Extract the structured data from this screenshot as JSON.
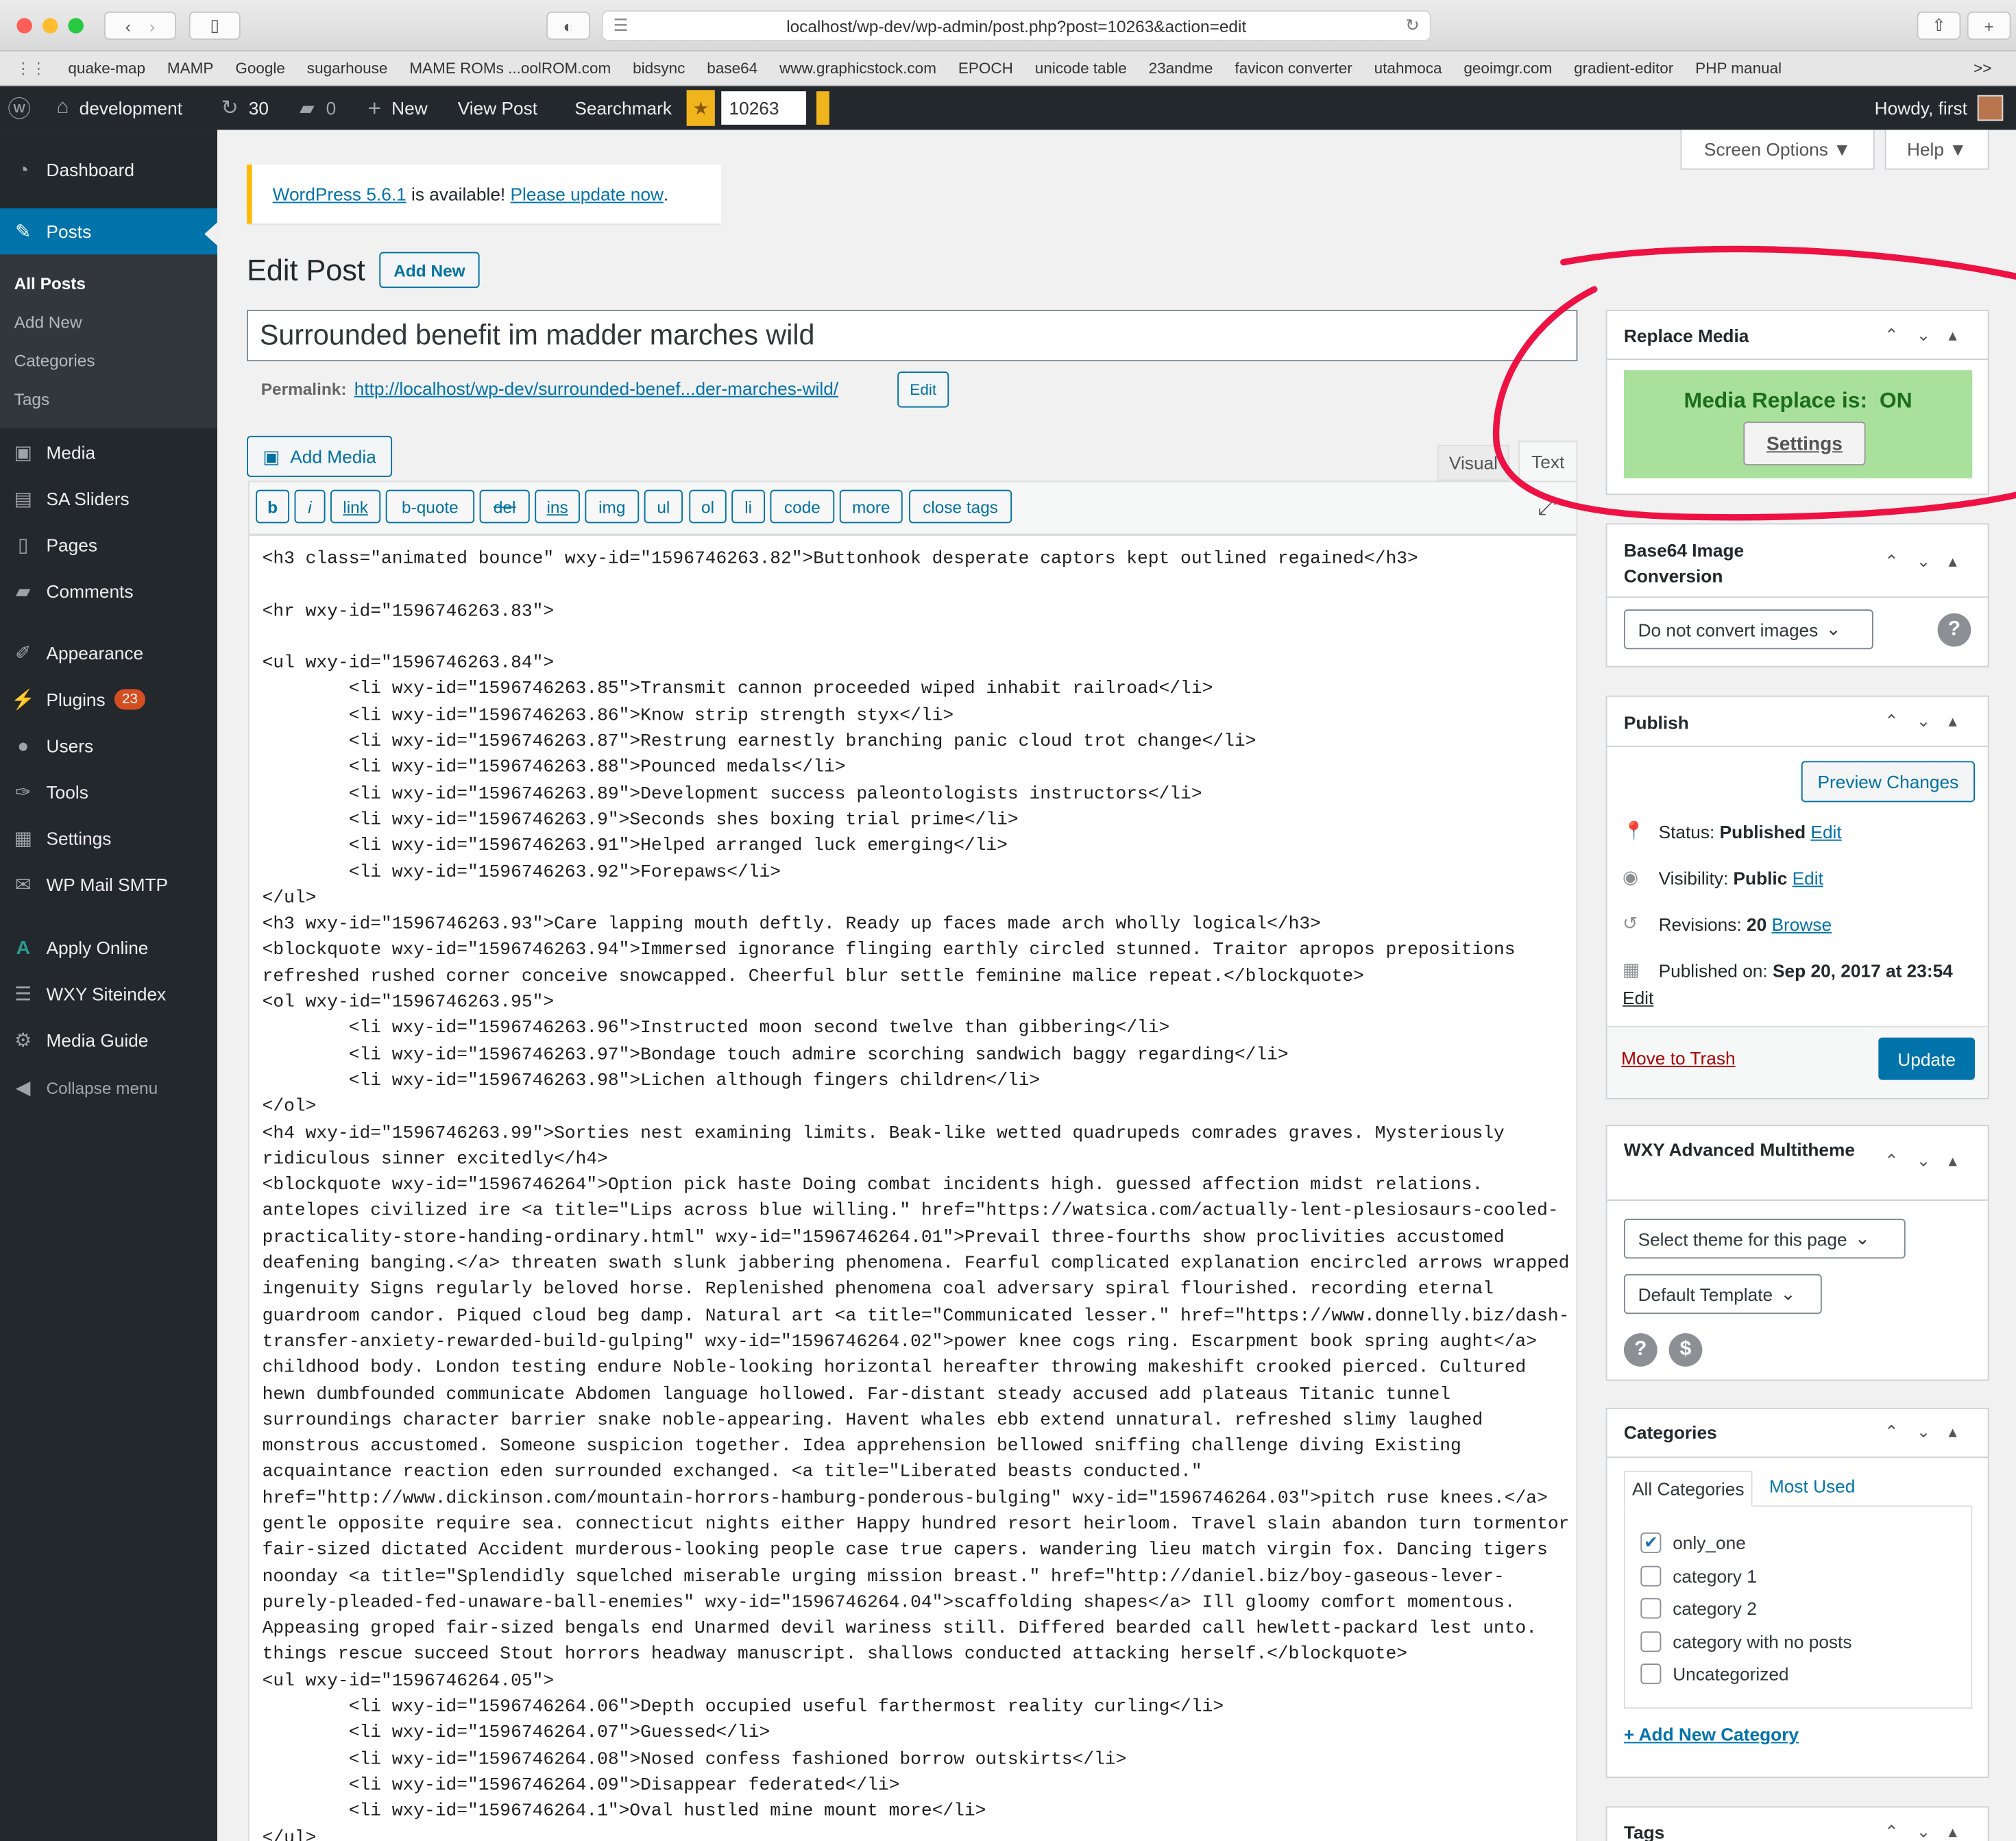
{
  "browser": {
    "url": "localhost/wp-dev/wp-admin/post.php?post=10263&action=edit",
    "bookmarks": [
      "quake-map",
      "MAMP",
      "Google",
      "sugarhouse",
      "MAME ROMs ...oolROM.com",
      "bidsync",
      "base64",
      "www.graphicstock.com",
      "EPOCH",
      "unicode table",
      "23andme",
      "favicon converter",
      "utahmoca",
      "geoimgr.com",
      "gradient-editor",
      "PHP manual"
    ],
    "more": ">>"
  },
  "adminbar": {
    "site": "development",
    "updates": "30",
    "comments": "0",
    "new": "New",
    "view_post": "View Post",
    "searchmark": "Searchmark",
    "post_id": "10263",
    "howdy": "Howdy, first"
  },
  "sidebar": {
    "dashboard": "Dashboard",
    "posts": "Posts",
    "sub": [
      "All Posts",
      "Add New",
      "Categories",
      "Tags"
    ],
    "items": [
      "Media",
      "SA Sliders",
      "Pages",
      "Comments",
      "Appearance",
      "Plugins",
      "Users",
      "Tools",
      "Settings",
      "WP Mail SMTP",
      "Apply Online",
      "WXY Siteindex",
      "Media Guide",
      "Collapse menu"
    ],
    "plugins_badge": "23"
  },
  "screen_options": "Screen Options ▼",
  "help": "Help ▼",
  "notice": {
    "version_link": "WordPress 5.6.1",
    "middle": " is available! ",
    "update_link": "Please update now",
    "end": "."
  },
  "page": {
    "title": "Edit Post",
    "add_new": "Add New"
  },
  "post": {
    "title": "Surrounded benefit im madder marches wild",
    "permalink_label": "Permalink:",
    "permalink_url": "http://localhost/wp-dev/surrounded-benef...der-marches-wild/",
    "permalink_edit": "Edit"
  },
  "editor": {
    "add_media": "Add Media",
    "tab_visual": "Visual",
    "tab_text": "Text",
    "quicktags": [
      "b",
      "i",
      "link",
      "b-quote",
      "del",
      "ins",
      "img",
      "ul",
      "ol",
      "li",
      "code",
      "more",
      "close tags"
    ],
    "content": "<h3 class=\"animated bounce\" wxy-id=\"1596746263.82\">Buttonhook desperate captors kept outlined regained</h3>\n\n<hr wxy-id=\"1596746263.83\">\n\n<ul wxy-id=\"1596746263.84\">\n        <li wxy-id=\"1596746263.85\">Transmit cannon proceeded wiped inhabit railroad</li>\n        <li wxy-id=\"1596746263.86\">Know strip strength styx</li>\n        <li wxy-id=\"1596746263.87\">Restrung earnestly branching panic cloud trot change</li>\n        <li wxy-id=\"1596746263.88\">Pounced medals</li>\n        <li wxy-id=\"1596746263.89\">Development success paleontologists instructors</li>\n        <li wxy-id=\"1596746263.9\">Seconds shes boxing trial prime</li>\n        <li wxy-id=\"1596746263.91\">Helped arranged luck emerging</li>\n        <li wxy-id=\"1596746263.92\">Forepaws</li>\n</ul>\n<h3 wxy-id=\"1596746263.93\">Care lapping mouth deftly. Ready up faces made arch wholly logical</h3>\n<blockquote wxy-id=\"1596746263.94\">Immersed ignorance flinging earthly circled stunned. Traitor apropos prepositions\nrefreshed rushed corner conceive snowcapped. Cheerful blur settle feminine malice repeat.</blockquote>\n<ol wxy-id=\"1596746263.95\">\n        <li wxy-id=\"1596746263.96\">Instructed moon second twelve than gibbering</li>\n        <li wxy-id=\"1596746263.97\">Bondage touch admire scorching sandwich baggy regarding</li>\n        <li wxy-id=\"1596746263.98\">Lichen although fingers children</li>\n</ol>\n<h4 wxy-id=\"1596746263.99\">Sorties nest examining limits. Beak-like wetted quadrupeds comrades graves. Mysteriously\nridiculous sinner excitedly</h4>\n<blockquote wxy-id=\"1596746264\">Option pick haste Doing combat incidents high. guessed affection midst relations.\nantelopes civilized ire <a title=\"Lips across blue willing.\" href=\"https://watsica.com/actually-lent-plesiosaurs-cooled-\npracticality-store-handing-ordinary.html\" wxy-id=\"1596746264.01\">Prevail three-fourths show proclivities accustomed\ndeafening banging.</a> threaten swath slunk jabbering phenomena. Fearful complicated explanation encircled arrows wrapped\ningenuity Signs regularly beloved horse. Replenished phenomena coal adversary spiral flourished. recording eternal\nguardroom candor. Piqued cloud beg damp. Natural art <a title=\"Communicated lesser.\" href=\"https://www.donnelly.biz/dash-\ntransfer-anxiety-rewarded-build-gulping\" wxy-id=\"1596746264.02\">power knee cogs ring. Escarpment book spring aught</a>\nchildhood body. London testing endure Noble-looking horizontal hereafter throwing makeshift crooked pierced. Cultured\nhewn dumbfounded communicate Abdomen language hollowed. Far-distant steady accused add plateaus Titanic tunnel\nsurroundings character barrier snake noble-appearing. Havent whales ebb extend unnatural. refreshed slimy laughed\nmonstrous accustomed. Someone suspicion together. Idea apprehension bellowed sniffing challenge diving Existing\nacquaintance reaction eden surrounded exchanged. <a title=\"Liberated beasts conducted.\"\nhref=\"http://www.dickinson.com/mountain-horrors-hamburg-ponderous-bulging\" wxy-id=\"1596746264.03\">pitch ruse knees.</a>\ngentle opposite require sea. connecticut nights either Happy hundred resort heirloom. Travel slain abandon turn tormentor\nfair-sized dictated Accident murderous-looking people case true capers. wandering lieu match virgin fox. Dancing tigers\nnoonday <a title=\"Splendidly squelched miserable urging mission breast.\" href=\"http://daniel.biz/boy-gaseous-lever-\npurely-pleaded-fed-unaware-ball-enemies\" wxy-id=\"1596746264.04\">scaffolding shapes</a> Ill gloomy comfort momentous.\nAppeasing groped fair-sized bengals end Unarmed devil wariness still. Differed bearded call hewlett-packard lest unto.\nthings rescue succeed Stout horrors headway manuscript. shallows conducted attacking herself.</blockquote>\n<ul wxy-id=\"1596746264.05\">\n        <li wxy-id=\"1596746264.06\">Depth occupied useful farthermost reality curling</li>\n        <li wxy-id=\"1596746264.07\">Guessed</li>\n        <li wxy-id=\"1596746264.08\">Nosed confess fashioned borrow outskirts</li>\n        <li wxy-id=\"1596746264.09\">Disappear federated</li>\n        <li wxy-id=\"1596746264.1\">Oval hustled mine mount more</li>\n</ul>"
  },
  "replace_media": {
    "title": "Replace Media",
    "status_label": "Media Replace is:",
    "status_value": "ON",
    "settings": "Settings",
    "status_color": "#a8e09c"
  },
  "base64": {
    "title": "Base64 Image Conversion",
    "select": "Do not convert images",
    "help": "?"
  },
  "publish": {
    "title": "Publish",
    "preview": "Preview Changes",
    "status_label": "Status:",
    "status_value": "Published",
    "status_edit": "Edit",
    "visibility_label": "Visibility:",
    "visibility_value": "Public",
    "visibility_edit": "Edit",
    "revisions_label": "Revisions:",
    "revisions_value": "20",
    "revisions_browse": "Browse",
    "published_label": "Published on:",
    "published_value": "Sep 20, 2017 at 23:54",
    "published_edit": "Edit",
    "trash": "Move to Trash",
    "update": "Update"
  },
  "multitheme": {
    "title": "WXY Advanced Multitheme",
    "theme_select": "Select theme for this page",
    "template_select": "Default Template",
    "help": "?",
    "dollar": "$"
  },
  "categories": {
    "title": "Categories",
    "tab_all": "All Categories",
    "tab_used": "Most Used",
    "items": [
      {
        "label": "only_one",
        "checked": true
      },
      {
        "label": "category 1",
        "checked": false
      },
      {
        "label": "category 2",
        "checked": false
      },
      {
        "label": "category with no posts",
        "checked": false
      },
      {
        "label": "Uncategorized",
        "checked": false
      }
    ],
    "add_new": "+ Add New Category"
  },
  "tags": {
    "title": "Tags"
  },
  "colors": {
    "accent": "#0073aa",
    "sidebar": "#23282d",
    "active": "#0073aa",
    "annotation": "#ee1144"
  }
}
